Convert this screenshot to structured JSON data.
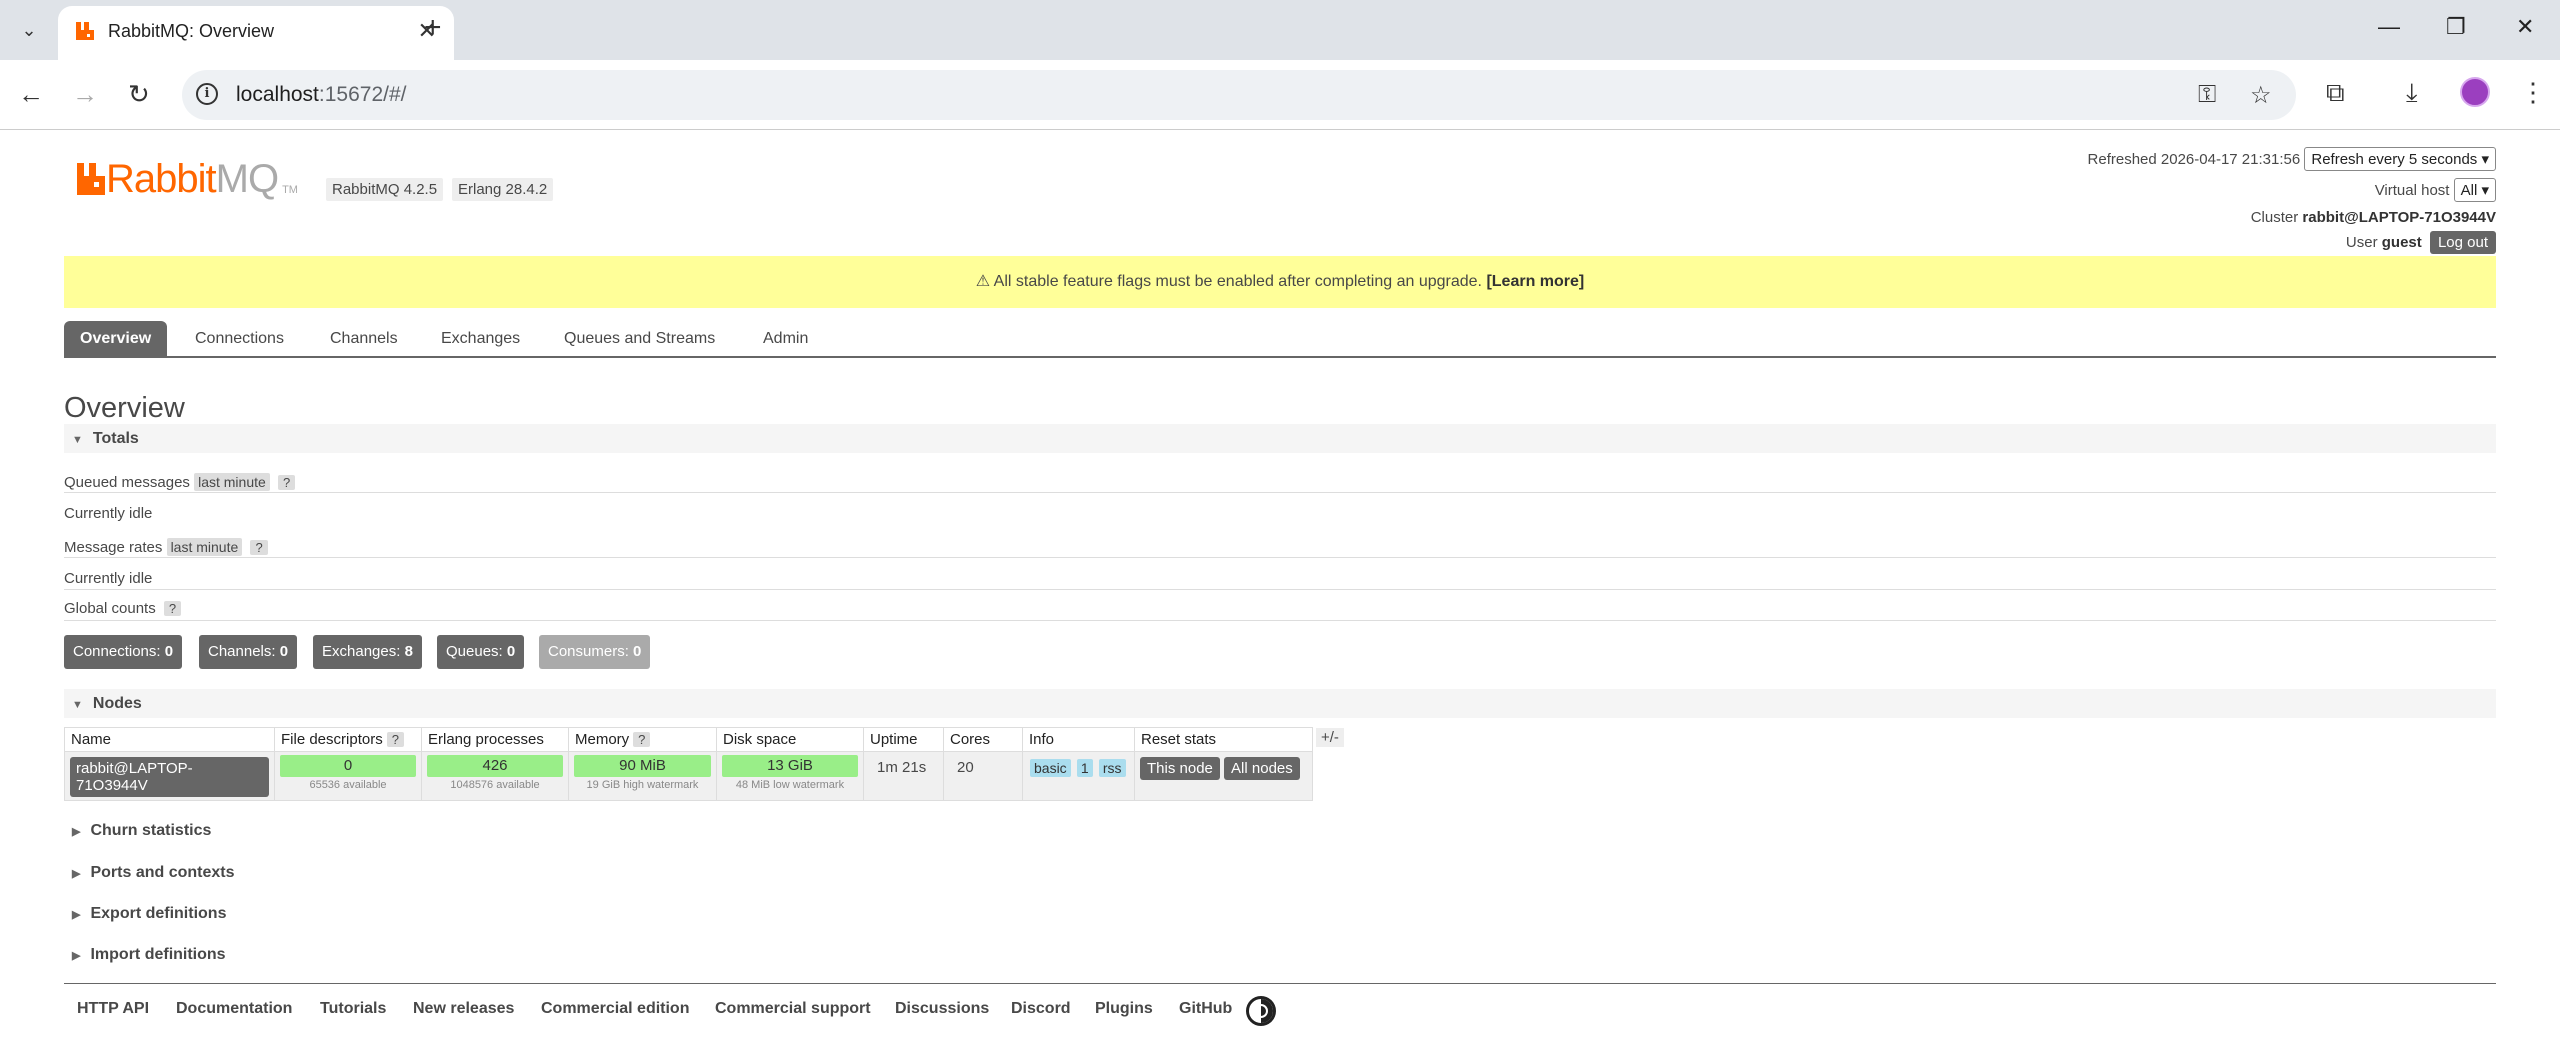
{
  "browser": {
    "tab_title": "RabbitMQ: Overview",
    "url_host": "localhost",
    "url_path": ":15672/#/"
  },
  "header": {
    "logo_rabbit": "Rabbit",
    "logo_mq": "MQ",
    "logo_tm": "TM",
    "rabbitmq_version": "RabbitMQ 4.2.5",
    "erlang_version": "Erlang 28.4.2",
    "refreshed_label": "Refreshed 2026-04-17 21:31:56",
    "refresh_select": "Refresh every 5 seconds ▾",
    "vhost_label": "Virtual host",
    "vhost_select": "All ▾",
    "cluster_label": "Cluster",
    "cluster_name": "rabbit@LAPTOP-71O3944V",
    "user_label": "User",
    "user_name": "guest",
    "logout": "Log out"
  },
  "banner": {
    "text": "⚠ All stable feature flags must be enabled after completing an upgrade.",
    "link": "[Learn more]"
  },
  "nav_tabs": [
    "Overview",
    "Connections",
    "Channels",
    "Exchanges",
    "Queues and Streams",
    "Admin"
  ],
  "page_title": "Overview",
  "totals": {
    "header": "Totals",
    "queued_messages": "Queued messages",
    "queued_range": "last minute",
    "queued_status": "Currently idle",
    "message_rates": "Message rates",
    "rates_range": "last minute",
    "rates_status": "Currently idle",
    "global_counts": "Global counts",
    "help": "?"
  },
  "counts": {
    "connections_label": "Connections:",
    "connections": "0",
    "channels_label": "Channels:",
    "channels": "0",
    "exchanges_label": "Exchanges:",
    "exchanges": "8",
    "queues_label": "Queues:",
    "queues": "0",
    "consumers_label": "Consumers:",
    "consumers": "0"
  },
  "nodes": {
    "header": "Nodes",
    "columns": [
      "Name",
      "File descriptors",
      "Erlang processes",
      "Memory",
      "Disk space",
      "Uptime",
      "Cores",
      "Info",
      "Reset stats"
    ],
    "plus_minus": "+/-",
    "row": {
      "name": "rabbit@LAPTOP-71O3944V",
      "fd": "0",
      "fd_sub": "65536 available",
      "proc": "426",
      "proc_sub": "1048576 available",
      "mem": "90 MiB",
      "mem_sub": "19 GiB high watermark",
      "disk": "13 GiB",
      "disk_sub": "48 MiB low watermark",
      "uptime": "1m 21s",
      "cores": "20",
      "info_tags": [
        "basic",
        "1",
        "rss"
      ],
      "reset_this": "This node",
      "reset_all": "All nodes"
    }
  },
  "collapsed_sections": [
    "Churn statistics",
    "Ports and contexts",
    "Export definitions",
    "Import definitions"
  ],
  "footer_links": [
    "HTTP API",
    "Documentation",
    "Tutorials",
    "New releases",
    "Commercial edition",
    "Commercial support",
    "Discussions",
    "Discord",
    "Plugins",
    "GitHub"
  ],
  "colors": {
    "brand": "#ff6600",
    "banner": "#ffff99",
    "bar_green": "#99ee88",
    "tag_blue": "#aaddee",
    "dark_button": "#666666"
  }
}
